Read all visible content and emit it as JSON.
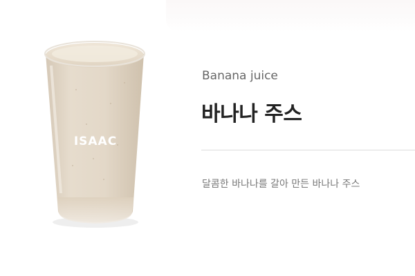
{
  "product": {
    "name_en": "Banana juice",
    "name_ko": "바나나 주스",
    "description": "달콤한 바나나를 갈아 만든 바나나 주스",
    "image_label": "ISAAC"
  },
  "colors": {
    "title": "#222222",
    "subtitle": "#666666",
    "description": "#777777",
    "divider": "#dcdcdc",
    "juice": "#e2d6c6"
  }
}
